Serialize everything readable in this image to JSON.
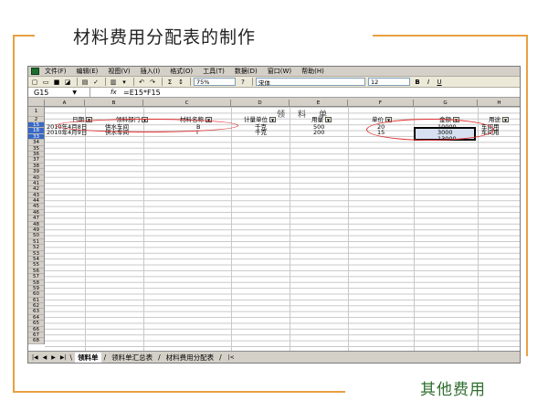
{
  "slide": {
    "title": "材料费用分配表的制作",
    "subtitle": "其他费用"
  },
  "excel": {
    "menu": [
      "文件(F)",
      "编辑(E)",
      "视图(V)",
      "插入(I)",
      "格式(O)",
      "工具(T)",
      "数据(D)",
      "窗口(W)",
      "帮助(H)"
    ],
    "toolbar": {
      "zoom": "75%",
      "font_name": "宋体",
      "font_size": "12",
      "bold": "B",
      "italic": "I",
      "underline": "U"
    },
    "name_box": "G15",
    "fx": "fx",
    "formula": "=E15*F15",
    "columns": [
      "A",
      "B",
      "C",
      "D",
      "E",
      "F",
      "G",
      "H"
    ],
    "sheet_title": "领料单",
    "headers": [
      "日期",
      "领料部门",
      "材料名称",
      "计量单位",
      "用量",
      "单价",
      "金额",
      "用途"
    ],
    "row_numbers": [
      "1",
      "2",
      "15",
      "18",
      "33",
      "34",
      "35",
      "36",
      "37",
      "38",
      "39",
      "40",
      "41",
      "42",
      "43",
      "44",
      "45",
      "46",
      "47",
      "48",
      "49",
      "50",
      "51",
      "52",
      "53",
      "54",
      "55",
      "56",
      "57",
      "58",
      "59",
      "60",
      "61",
      "62",
      "63",
      "64",
      "65",
      "66",
      "67",
      "68"
    ],
    "rows": [
      {
        "date": "2010年4月8日",
        "dept": "供水车间",
        "material": "B",
        "unit": "千克",
        "qty": "500",
        "price": "20",
        "amount": "10000",
        "use": "车间用"
      },
      {
        "date": "2010年4月9日",
        "dept": "供水车间",
        "material": "I",
        "unit": "千克",
        "qty": "200",
        "price": "15",
        "amount": "3000",
        "use": "车间用"
      }
    ],
    "total": "13000",
    "sheet_tabs": [
      "领料单",
      "领料单汇总表",
      "材料费用分配表"
    ]
  }
}
